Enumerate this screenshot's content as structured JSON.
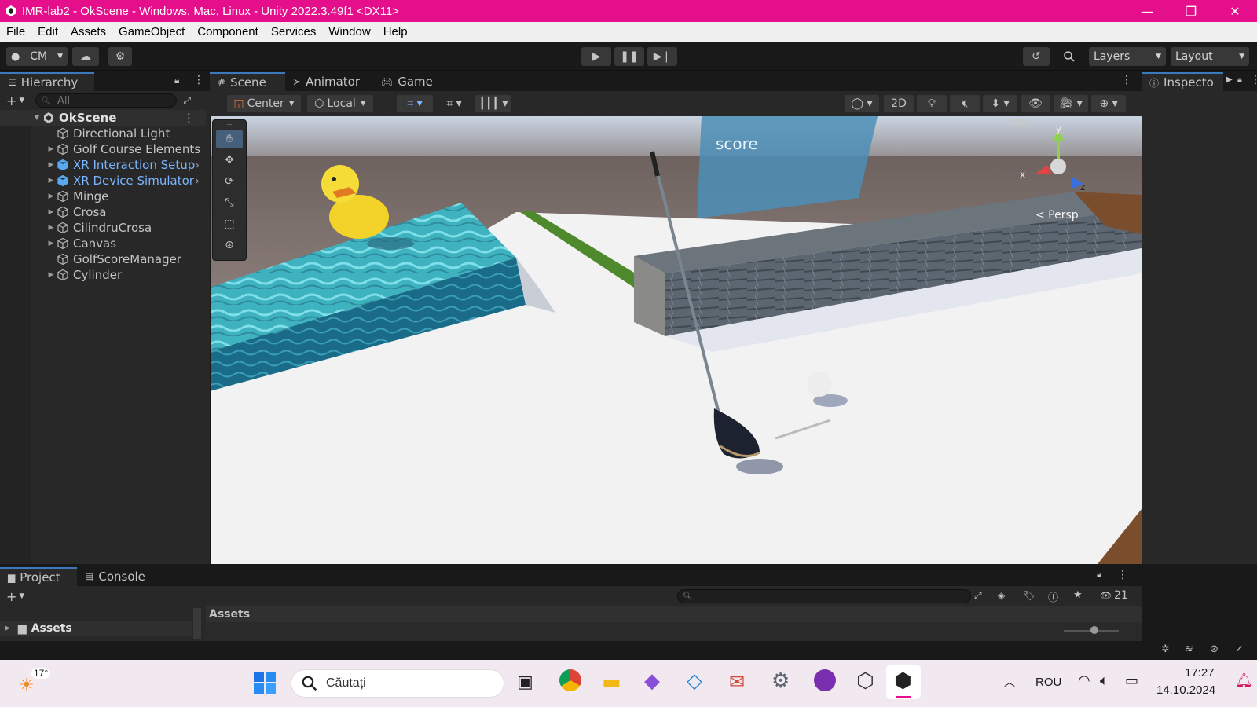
{
  "window": {
    "title": "IMR-lab2 - OkScene - Windows, Mac, Linux - Unity 2022.3.49f1 <DX11>",
    "minimize": "—",
    "maximize": "❐",
    "close": "✕"
  },
  "menu": [
    "File",
    "Edit",
    "Assets",
    "GameObject",
    "Component",
    "Services",
    "Window",
    "Help"
  ],
  "toolbar": {
    "account": "CM",
    "layers": "Layers",
    "layout": "Layout"
  },
  "hierarchy": {
    "tab": "Hierarchy",
    "search_placeholder": "All",
    "scene": "OkScene",
    "items": [
      {
        "label": "Directional Light",
        "expandable": false,
        "prefab": false
      },
      {
        "label": "Golf Course Elements",
        "expandable": true,
        "prefab": false
      },
      {
        "label": "XR Interaction Setup",
        "expandable": true,
        "prefab": true
      },
      {
        "label": "XR Device Simulator",
        "expandable": true,
        "prefab": true
      },
      {
        "label": "Minge",
        "expandable": true,
        "prefab": false
      },
      {
        "label": "Crosa",
        "expandable": true,
        "prefab": false
      },
      {
        "label": "CilindruCrosa",
        "expandable": true,
        "prefab": false
      },
      {
        "label": "Canvas",
        "expandable": true,
        "prefab": false
      },
      {
        "label": "GolfScoreManager",
        "expandable": false,
        "prefab": false
      },
      {
        "label": "Cylinder",
        "expandable": true,
        "prefab": false
      }
    ]
  },
  "scene_tabs": [
    "Scene",
    "Animator",
    "Game"
  ],
  "scene_toolbar": {
    "pivot": "Center",
    "space": "Local",
    "mode_2d": "2D"
  },
  "scene_view": {
    "score_label": "score",
    "persp_label": "< Persp",
    "axis_x": "x",
    "axis_y": "y",
    "axis_z": "z"
  },
  "inspector": {
    "tab": "Inspecto"
  },
  "bottom": {
    "tabs": [
      "Project",
      "Console"
    ],
    "breadcrumb": "Assets",
    "folder": "Assets",
    "hidden_count": "21"
  },
  "taskbar": {
    "weather": "17°",
    "search_placeholder": "Căutați",
    "lang": "ROU",
    "time": "17:27",
    "date": "14.10.2024"
  },
  "colors": {
    "titlebar": "#e60f8b",
    "accent_blue": "#3a79bb",
    "prefab_blue": "#7bb5ff"
  }
}
